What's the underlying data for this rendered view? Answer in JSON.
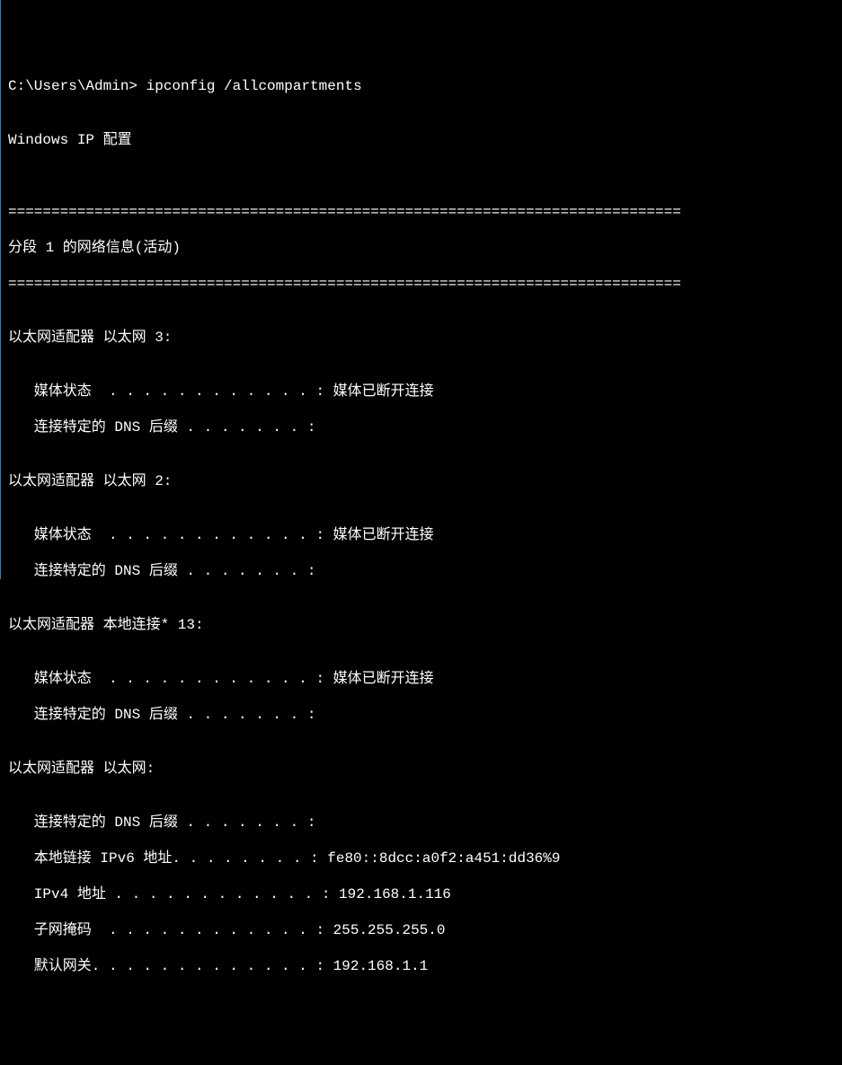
{
  "terminal": {
    "prompt": "C:\\Users\\Admin> ",
    "command": "ipconfig /allcompartments",
    "blank1": "",
    "header": "Windows IP 配置",
    "blank2": "",
    "blank3": "",
    "divider_top": "==============================================================================",
    "compartment_title": "分段 1 的网络信息(活动)",
    "divider_bottom": "==============================================================================",
    "blank4": "",
    "adapter1": {
      "title": "以太网适配器 以太网 3:",
      "blank": "",
      "media_state": "   媒体状态  . . . . . . . . . . . . : 媒体已断开连接",
      "dns_suffix": "   连接特定的 DNS 后缀 . . . . . . . :"
    },
    "blank5": "",
    "adapter2": {
      "title": "以太网适配器 以太网 2:",
      "blank": "",
      "media_state": "   媒体状态  . . . . . . . . . . . . : 媒体已断开连接",
      "dns_suffix": "   连接特定的 DNS 后缀 . . . . . . . :"
    },
    "blank6": "",
    "adapter3": {
      "title": "以太网适配器 本地连接* 13:",
      "blank": "",
      "media_state": "   媒体状态  . . . . . . . . . . . . : 媒体已断开连接",
      "dns_suffix": "   连接特定的 DNS 后缀 . . . . . . . :"
    },
    "blank7": "",
    "adapter4": {
      "title": "以太网适配器 以太网:",
      "blank": "",
      "dns_suffix": "   连接特定的 DNS 后缀 . . . . . . . :",
      "ipv6": "   本地链接 IPv6 地址. . . . . . . . : fe80::8dcc:a0f2:a451:dd36%9",
      "ipv4": "   IPv4 地址 . . . . . . . . . . . . : 192.168.1.116",
      "subnet": "   子网掩码  . . . . . . . . . . . . : 255.255.255.0",
      "gateway": "   默认网关. . . . . . . . . . . . . : 192.168.1.1"
    }
  }
}
